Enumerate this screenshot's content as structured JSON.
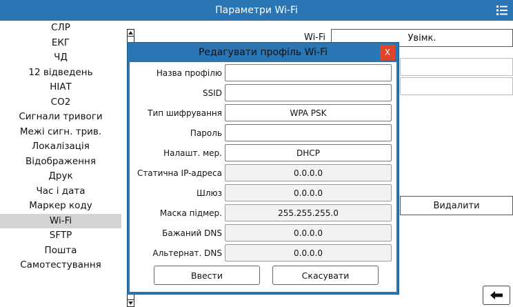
{
  "header": {
    "title": "Параметри Wi-Fi",
    "menu_icon": "menu-list-icon"
  },
  "sidebar": {
    "items": [
      {
        "label": "СЛР"
      },
      {
        "label": "ЕКГ"
      },
      {
        "label": "ЧД"
      },
      {
        "label": "12 відведень"
      },
      {
        "label": "НІАТ"
      },
      {
        "label": "CO2"
      },
      {
        "label": "Сигнали тривоги"
      },
      {
        "label": "Межі сигн. трив."
      },
      {
        "label": "Локалізація"
      },
      {
        "label": "Відображення"
      },
      {
        "label": "Друк"
      },
      {
        "label": "Час і дата"
      },
      {
        "label": "Маркер коду"
      },
      {
        "label": "Wi-Fi"
      },
      {
        "label": "SFTP"
      },
      {
        "label": "Пошта"
      },
      {
        "label": "Самотестування"
      }
    ],
    "selected": "Wi-Fi"
  },
  "background": {
    "wifi_label": "Wi-Fi",
    "wifi_value": "Увімк.",
    "delete_label": "Видалити"
  },
  "dialog": {
    "title": "Редагувати профіль Wi-Fi",
    "close_label": "X",
    "fields": [
      {
        "label": "Назва профілю",
        "value": ""
      },
      {
        "label": "SSID",
        "value": ""
      },
      {
        "label": "Тип шифрування",
        "value": "WPA PSK"
      },
      {
        "label": "Пароль",
        "value": ""
      },
      {
        "label": "Налашт. мер.",
        "value": "DHCP"
      },
      {
        "label": "Статична IP-адреса",
        "value": "0.0.0.0"
      },
      {
        "label": "Шлюз",
        "value": "0.0.0.0"
      },
      {
        "label": "Маска підмер.",
        "value": "255.255.255.0"
      },
      {
        "label": "Бажаний DNS",
        "value": "0.0.0.0"
      },
      {
        "label": "Альтернат. DNS",
        "value": "0.0.0.0"
      }
    ],
    "enter_label": "Ввести",
    "cancel_label": "Скасувати"
  },
  "back_icon": "back-arrow-icon"
}
